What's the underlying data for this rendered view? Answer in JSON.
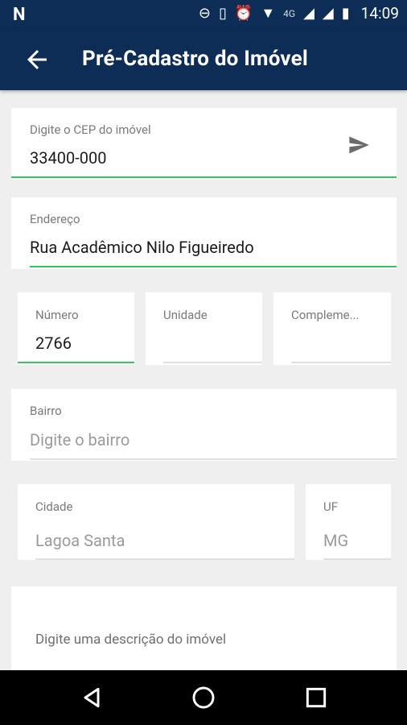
{
  "status_bar": {
    "time": "14:09",
    "network": "4G"
  },
  "app_bar": {
    "title": "Pré-Cadastro do Imóvel"
  },
  "form": {
    "cep": {
      "label": "Digite o CEP do imóvel",
      "value": "33400-000"
    },
    "endereco": {
      "label": "Endereço",
      "value": "Rua Acadêmico Nilo Figueiredo"
    },
    "numero": {
      "label": "Número",
      "value": "2766"
    },
    "unidade": {
      "label": "Unidade",
      "value": ""
    },
    "complemento": {
      "label": "Compleme...",
      "value": ""
    },
    "bairro": {
      "label": "Bairro",
      "placeholder": "Digite o bairro"
    },
    "cidade": {
      "label": "Cidade",
      "value": "Lagoa Santa"
    },
    "uf": {
      "label": "UF",
      "value": "MG"
    },
    "descricao": {
      "placeholder": "Digite uma descrição do imóvel"
    }
  },
  "colors": {
    "primary": "#0d2d57",
    "accent_line": "#34c759",
    "background": "#efefef"
  }
}
